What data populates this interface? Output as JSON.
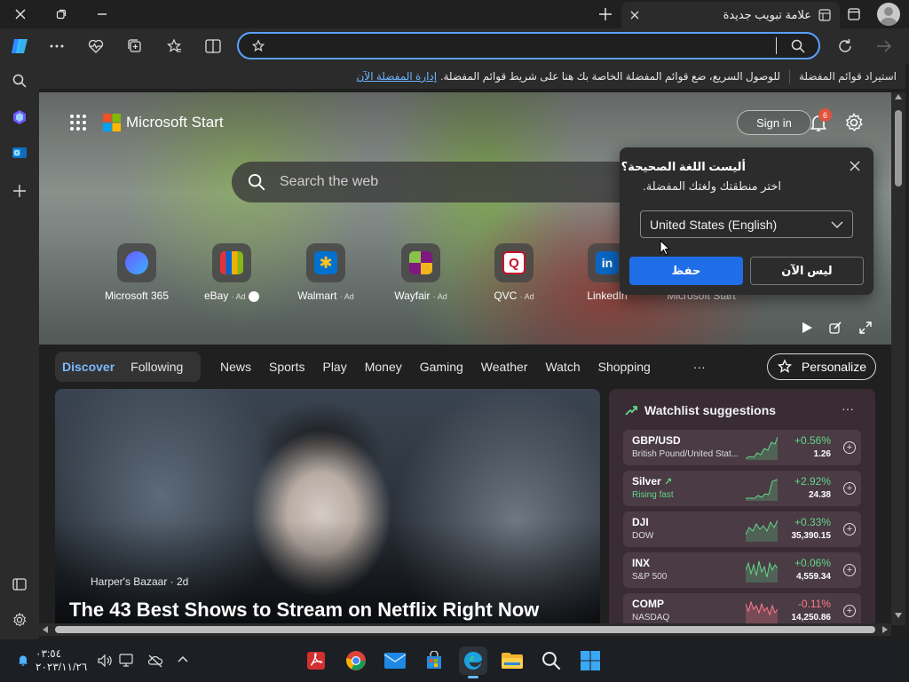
{
  "tab": {
    "title": "علامة تبويب جديدة"
  },
  "favorites_bar": {
    "import_label": "استيراد قوائم المفضلة",
    "message": "للوصول السريع، ضع قوائم المفضلة الخاصة بك هنا على شريط قوائم المفضلة.",
    "manage_link": "إدارة المفضلة الآن"
  },
  "page": {
    "brand": "Microsoft Start",
    "sign_in": "Sign in",
    "notification_count": "6",
    "search_placeholder": "Search the web",
    "tiles": [
      {
        "label": "Microsoft 365",
        "ad": ""
      },
      {
        "label": "eBay",
        "ad": "· Ad"
      },
      {
        "label": "Walmart",
        "ad": "· Ad"
      },
      {
        "label": "Wayfair",
        "ad": "· Ad"
      },
      {
        "label": "QVC",
        "ad": "· Ad"
      },
      {
        "label": "LinkedIn",
        "ad": ""
      },
      {
        "label": "Microsoft Start",
        "ad": ""
      }
    ],
    "nav_tabs": [
      "Discover",
      "Following"
    ],
    "nav_links": [
      "News",
      "Sports",
      "Play",
      "Money",
      "Gaming",
      "Weather",
      "Watch",
      "Shopping"
    ],
    "nav_more": "···",
    "personalize": "Personalize",
    "hero": {
      "source": "Harper's Bazaar · 2d",
      "title": "The 43 Best Shows to Stream on Netflix Right Now"
    },
    "watchlist": {
      "title": "Watchlist suggestions",
      "more": "···",
      "items": [
        {
          "symbol": "GBP/USD",
          "sub": "British Pound/United Stat...",
          "change": "+0.56%",
          "price": "1.26",
          "trend": "up"
        },
        {
          "symbol": "Silver",
          "sub": "Rising fast",
          "change": "+2.92%",
          "price": "24.38",
          "trend": "up"
        },
        {
          "symbol": "DJI",
          "sub": "DOW",
          "change": "+0.33%",
          "price": "35,390.15",
          "trend": "up"
        },
        {
          "symbol": "INX",
          "sub": "S&P 500",
          "change": "+0.06%",
          "price": "4,559.34",
          "trend": "up"
        },
        {
          "symbol": "COMP",
          "sub": "NASDAQ",
          "change": "-0.11%",
          "price": "14,250.86",
          "trend": "down"
        }
      ]
    }
  },
  "popup": {
    "title": "أليست اللغة الصحيحة؟",
    "subtitle": "اختر منطقتك ولغتك المفضلة.",
    "selected_region": "United States (English)",
    "save": "حفظ",
    "not_now": "ليس الآن"
  },
  "taskbar": {
    "time": "٠٣:٥٤",
    "date": "٢٠٢٣/١١/٢٦"
  },
  "colors": {
    "accent": "#1f6ee8",
    "link": "#6db4ff",
    "positive": "#63d68a",
    "negative": "#ff7a8a"
  }
}
